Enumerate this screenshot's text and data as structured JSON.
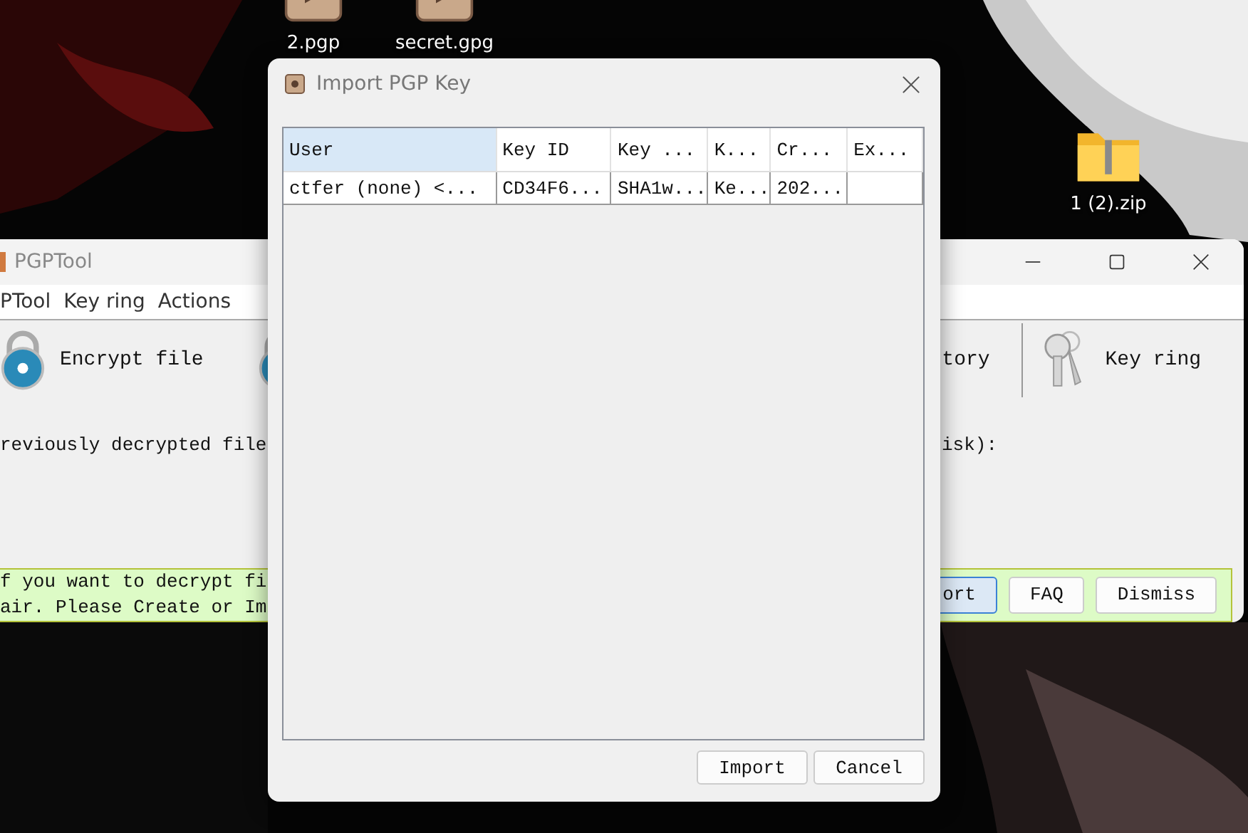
{
  "desktop": {
    "icons": [
      {
        "label": "2.pgp",
        "kind": "file"
      },
      {
        "label": "secret.gpg",
        "kind": "file"
      },
      {
        "label": "1 (2).zip",
        "kind": "zip"
      }
    ]
  },
  "main_window": {
    "title": "PGPTool",
    "menu": [
      "PTool",
      "Key ring",
      "Actions"
    ],
    "toolbar_left": [
      {
        "label": "Encrypt file",
        "kind": "lock"
      }
    ],
    "toolbar_right": [
      {
        "label": "tory",
        "kind": "text"
      },
      {
        "label": "Key ring",
        "kind": "keys"
      }
    ],
    "history_left": "reviously decrypted file",
    "history_right": "isk):",
    "notice": {
      "lines": [
        "f you want to decrypt fi",
        "air. Please Create or Im"
      ],
      "buttons": [
        {
          "label": "ort",
          "selected": true
        },
        {
          "label": "FAQ",
          "selected": false
        },
        {
          "label": "Dismiss",
          "selected": false
        }
      ]
    }
  },
  "dialog": {
    "title": "Import PGP Key",
    "table": {
      "columns": [
        {
          "label": "User",
          "selected": true
        },
        {
          "label": "Key ID",
          "selected": false
        },
        {
          "label": "Key ...",
          "selected": false
        },
        {
          "label": "K...",
          "selected": false
        },
        {
          "label": "Cr...",
          "selected": false
        },
        {
          "label": "Ex...",
          "selected": false
        }
      ],
      "rows": [
        {
          "cells": [
            "ctfer (none) <...",
            "CD34F6...",
            "SHA1w...",
            "Ke...",
            "202..."
          ]
        }
      ]
    },
    "buttons": [
      "Import",
      "Cancel"
    ]
  }
}
